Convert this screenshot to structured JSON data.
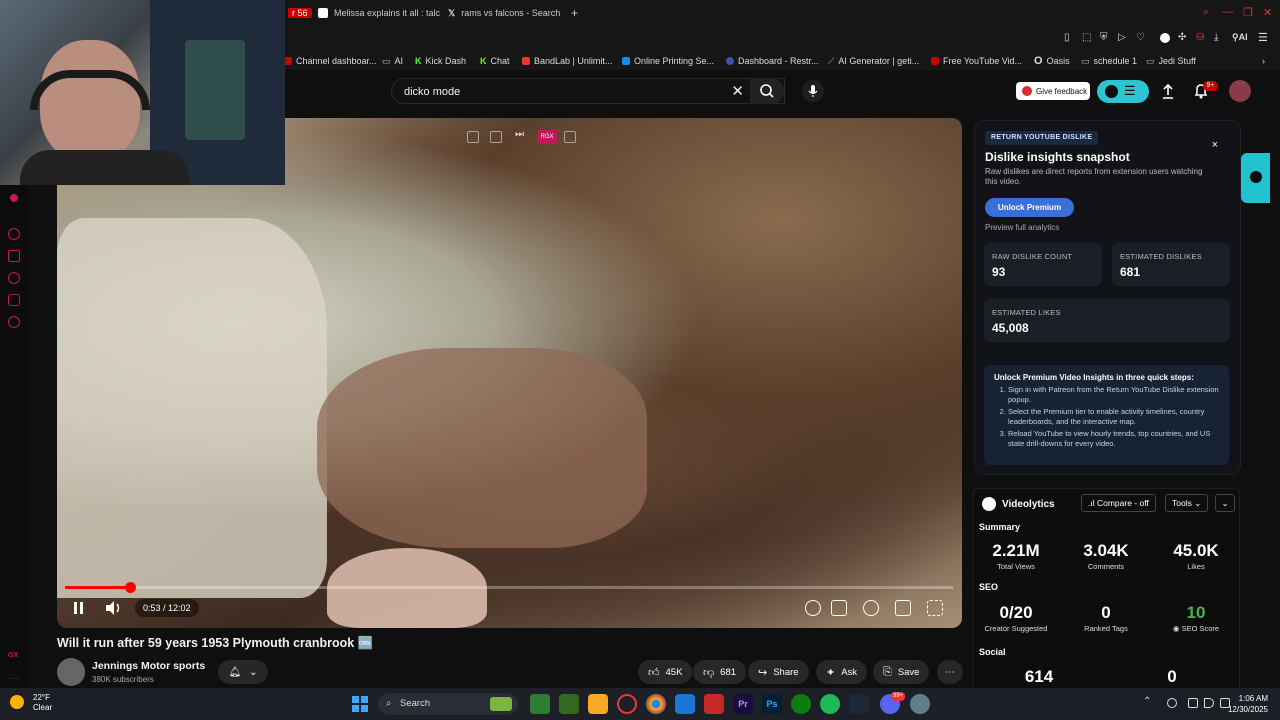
{
  "browser": {
    "tabs": [
      {
        "label": "r 56",
        "color": "#cc0000"
      },
      {
        "label": "Melissa explains it all : talc",
        "color": "#ffffff"
      },
      {
        "label": "rams vs falcons - Search",
        "color": "#ffffff"
      }
    ],
    "new_tab": "+",
    "profile_label": "AI",
    "bookmarks": [
      {
        "label": "Channel dashboar...",
        "color": "#cc0000"
      },
      {
        "label": "AI",
        "color": "#999999"
      },
      {
        "label": "Kick Dash",
        "color": "#53fc18"
      },
      {
        "label": "Chat",
        "color": "#53fc18"
      },
      {
        "label": "BandLab | Unlimit...",
        "color": "#e53935"
      },
      {
        "label": "Online Printing Se...",
        "color": "#1e88e5"
      },
      {
        "label": "Dashboard - Restr...",
        "color": "#3f51b5"
      },
      {
        "label": "AI Generator | geti...",
        "color": "#888888"
      },
      {
        "label": "Free YouTube Vid...",
        "color": "#cc0000"
      },
      {
        "label": "Oasis",
        "color": "#ffffff"
      },
      {
        "label": "schedule 1",
        "color": "#999999"
      },
      {
        "label": "Jedi Stuff",
        "color": "#999999"
      }
    ]
  },
  "youtube": {
    "search_value": "dicko mode",
    "give_feedback": "Give feedback",
    "notif_count": "9+"
  },
  "player": {
    "rgx_label": "RGX",
    "time": "0:53 / 12:02",
    "progress_fraction": 0.073,
    "title": "Will it run after 59 years 1953 Plymouth cranbrook 🆒",
    "channel": "Jennings Motor sports",
    "subscribers": "380K subscribers",
    "likes": "45K",
    "dislikes": "681",
    "share": "Share",
    "ask": "Ask",
    "save": "Save",
    "more": "⋯"
  },
  "ryd": {
    "tag": "RETURN YOUTUBE DISLIKE",
    "close": "×",
    "title": "Dislike insights snapshot",
    "desc": "Raw dislikes are direct reports from extension users watching this video.",
    "unlock": "Unlock Premium",
    "preview": "Preview full analytics",
    "raw_label": "RAW DISLIKE COUNT",
    "raw_value": "93",
    "est_dis_label": "ESTIMATED DISLIKES",
    "est_dis_value": "681",
    "est_likes_label": "ESTIMATED LIKES",
    "est_likes_value": "45,008",
    "premium_heading": "Unlock Premium Video Insights in three quick steps:",
    "steps": [
      "Sign in with Patreon from the Return YouTube Dislike extension popup.",
      "Select the Premium tier to enable activity timelines, country leaderboards, and the interactive map.",
      "Reload YouTube to view hourly trends, top countries, and US state drill-downs for every video."
    ]
  },
  "videolytics": {
    "name": "Videolytics",
    "compare": ".ıl Compare - off",
    "tools": "Tools ⌄",
    "expand": "⌄",
    "summary_label": "Summary",
    "views": "2.21M",
    "views_label": "Total Views",
    "comments": "3.04K",
    "comments_label": "Comments",
    "likes": "45.0K",
    "likes_label": "Likes",
    "seo_label": "SEO",
    "suggested": "0/20",
    "suggested_label": "Creator Suggested",
    "ranked": "0",
    "ranked_label": "Ranked Tags",
    "seo_score": "10",
    "seo_score_label": "SEO Score",
    "social_label": "Social",
    "social_a": "614",
    "social_b": "0"
  },
  "taskbar": {
    "temp": "22°F",
    "condition": "Clear",
    "search": "Search",
    "time": "1:06 AM",
    "date": "12/30/2025",
    "steam_badge": "99+"
  }
}
